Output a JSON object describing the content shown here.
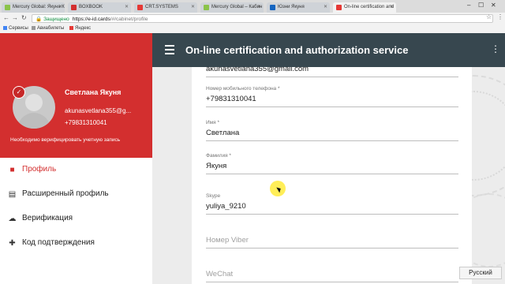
{
  "browser": {
    "tabs": [
      {
        "label": "Mercury Global: Якуня К",
        "color": "#8bc34a"
      },
      {
        "label": "BOXBOOK",
        "color": "#d32f2f"
      },
      {
        "label": "CRT.SYSTEMS",
        "color": "#e53935"
      },
      {
        "label": "Mercury Global – Кабин",
        "color": "#8bc34a"
      },
      {
        "label": "Юзни Якуня",
        "color": "#1565c0"
      },
      {
        "label": "On-line certification and",
        "color": "#e53935"
      }
    ],
    "address": {
      "secure_label": "Защищено",
      "host": "https://e-id.cards",
      "path": "/#/cabinet/profile"
    },
    "bookmarks": [
      "Сервисы",
      "Авиабилеты",
      "Яндекс"
    ]
  },
  "app": {
    "title": "On-line certification and authorization service"
  },
  "profile": {
    "name": "Светлана Якуня",
    "email": "akunasvetlana355@g...",
    "phone": "+79831310041",
    "verify_note": "Необходимо верифицировать учетную запись"
  },
  "nav": [
    {
      "label": "Профиль",
      "icon": "person-icon",
      "active": true
    },
    {
      "label": "Расширенный профиль",
      "icon": "id-card-icon",
      "active": false
    },
    {
      "label": "Верификация",
      "icon": "cloud-upload-icon",
      "active": false
    },
    {
      "label": "Код подтверждения",
      "icon": "person-add-icon",
      "active": false
    }
  ],
  "form": {
    "email_value": "akunasvetlana355@gmail.com",
    "phone_label": "Номер мобильного телефона *",
    "phone_value": "+79831310041",
    "name_label": "Имя *",
    "name_value": "Светлана",
    "surname_label": "Фамилия *",
    "surname_value": "Якуня",
    "skype_label": "Skype",
    "skype_value": "yuliya_9210",
    "viber_placeholder": "Номер Viber",
    "wechat_placeholder": "WeChat"
  },
  "system": {
    "language": "Русский"
  },
  "colors": {
    "accent_red": "#d32f2f",
    "header_dark": "#37474f",
    "secure_green": "#0a8a3a"
  }
}
